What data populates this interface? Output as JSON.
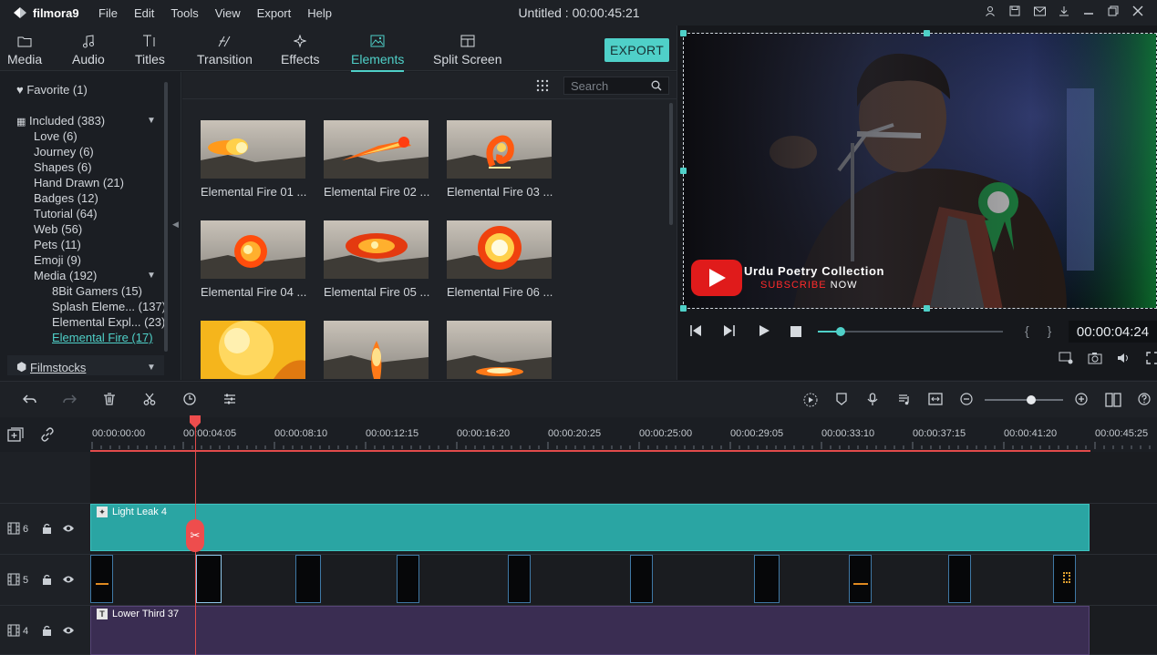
{
  "app": {
    "name": "filmora9",
    "menu": [
      "File",
      "Edit",
      "Tools",
      "View",
      "Export",
      "Help"
    ],
    "title": "Untitled : 00:00:45:21",
    "window_icons": [
      "user-icon",
      "save-icon",
      "mail-icon",
      "download-icon",
      "minimize-icon",
      "restore-icon",
      "close-icon"
    ]
  },
  "tabs": [
    {
      "label": "Media",
      "icon": "folder-icon"
    },
    {
      "label": "Audio",
      "icon": "music-note-icon"
    },
    {
      "label": "Titles",
      "icon": "text-icon"
    },
    {
      "label": "Transition",
      "icon": "transition-icon"
    },
    {
      "label": "Effects",
      "icon": "sparkle-icon"
    },
    {
      "label": "Elements",
      "icon": "image-icon"
    },
    {
      "label": "Split Screen",
      "icon": "split-screen-icon"
    }
  ],
  "active_tab": "Elements",
  "export_label": "EXPORT",
  "categories": {
    "favorite": "Favorite (1)",
    "included": "Included (383)",
    "items": [
      "Love (6)",
      "Journey (6)",
      "Shapes (6)",
      "Hand Drawn (21)",
      "Badges (12)",
      "Tutorial (64)",
      "Web (56)",
      "Pets (11)",
      "Emoji (9)"
    ],
    "media": "Media (192)",
    "media_items": [
      "8Bit Gamers (15)",
      "Splash Eleme... (137)",
      "Elemental Expl... (23)"
    ],
    "selected": "Elemental Fire (17)",
    "filmstocks": "Filmstocks"
  },
  "search": {
    "placeholder": "Search"
  },
  "elements": [
    "Elemental Fire 01 ...",
    "Elemental Fire 02 ...",
    "Elemental Fire 03 ...",
    "Elemental Fire 04 ...",
    "Elemental Fire 05 ...",
    "Elemental Fire 06 ..."
  ],
  "preview": {
    "overlay_title": "Urdu Poetry Collection",
    "overlay_subscribe": "SUBSCRIBE",
    "overlay_now": "NOW",
    "timecode": "00:00:04:24",
    "braces": "{ }",
    "progress": 0.12
  },
  "timeline": {
    "ticks": [
      "00:00:00:00",
      "00:00:04:05",
      "00:00:08:10",
      "00:00:12:15",
      "00:00:16:20",
      "00:00:20:25",
      "00:00:25:00",
      "00:00:29:05",
      "00:00:33:10",
      "00:00:37:15",
      "00:00:41:20",
      "00:00:45:25"
    ],
    "tracks": [
      {
        "num": "6",
        "clip": "Light Leak 4"
      },
      {
        "num": "5",
        "clip": ""
      },
      {
        "num": "4",
        "clip": "Lower Third 37"
      }
    ]
  },
  "colors": {
    "accent": "#4fd0c8",
    "playhead": "#e24b4b",
    "leak_clip": "#2aa5a3",
    "title_clip": "#3a2d52"
  }
}
